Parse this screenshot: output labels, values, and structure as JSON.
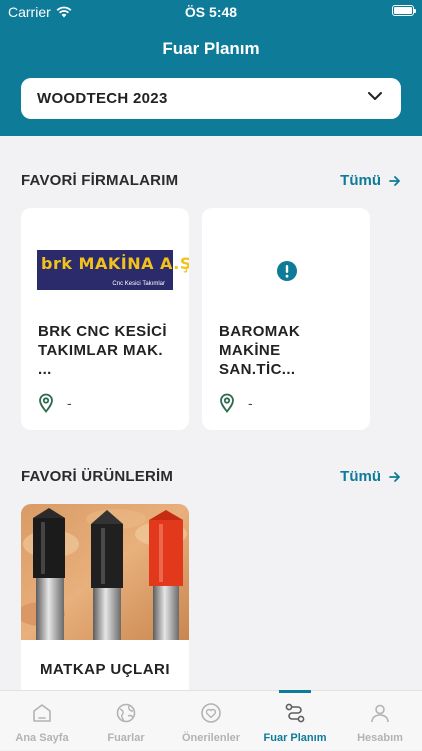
{
  "status_bar": {
    "carrier": "Carrier",
    "time": "ÖS 5:48"
  },
  "header": {
    "title": "Fuar Planım"
  },
  "fair_selector": {
    "value": "WOODTECH 2023"
  },
  "favorite_firms": {
    "title": "FAVORİ FİRMALARIM",
    "all_label": "Tümü",
    "items": [
      {
        "name": "BRK CNC KESİCİ TAKIMLAR MAK. ...",
        "location": "-",
        "logo_text": "brk MAKİNA A.Ş.",
        "logo_subtext": "Cnc Kesici Takımlar"
      },
      {
        "name": "BAROMAK MAKİNE SAN.TİC...",
        "location": "-"
      }
    ]
  },
  "favorite_products": {
    "title": "FAVORİ ÜRÜNLERİM",
    "all_label": "Tümü",
    "items": [
      {
        "name": "MATKAP UÇLARI"
      }
    ]
  },
  "tab_bar": {
    "tabs": [
      {
        "label": "Ana Sayfa",
        "icon": "home-icon",
        "active": false
      },
      {
        "label": "Fuarlar",
        "icon": "globe-icon",
        "active": false
      },
      {
        "label": "Önerilenler",
        "icon": "heart-icon",
        "active": false
      },
      {
        "label": "Fuar Planım",
        "icon": "route-icon",
        "active": true
      },
      {
        "label": "Hesabım",
        "icon": "user-icon",
        "active": false
      }
    ]
  },
  "colors": {
    "primary": "#0e7b99",
    "background": "#f2f2f4",
    "inactive_tab": "#b3b3b3"
  }
}
